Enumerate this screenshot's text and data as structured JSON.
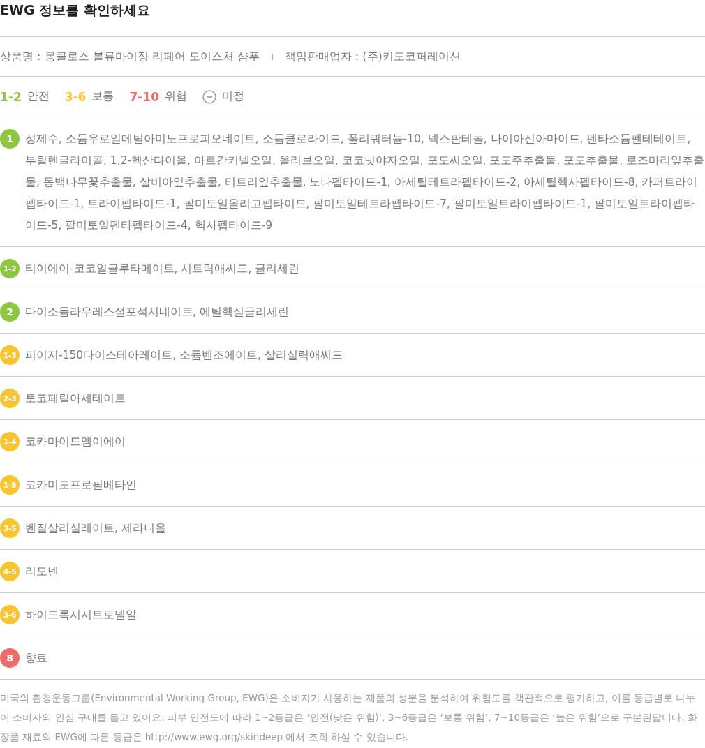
{
  "title": "EWG 정보를 확인하세요",
  "product": {
    "name_label": "상품명 : 몽클로스 볼류마이징 리페어 모이스처 샴푸",
    "separator": "I",
    "seller_label": "책임판매업자 : (주)키도코퍼레이션"
  },
  "legend": [
    {
      "kind": "range",
      "range": "1-2",
      "label": "안전",
      "color": "#8dc63f"
    },
    {
      "kind": "range",
      "range": "3-6",
      "label": "보통",
      "color": "#f7c531"
    },
    {
      "kind": "range",
      "range": "7-10",
      "label": "위험",
      "color": "#ee6b6b"
    },
    {
      "kind": "unrated",
      "label": "미정"
    }
  ],
  "ingredients": [
    {
      "grade": "1",
      "color": "#8dc63f",
      "names": "정제수, 소듐우로일메틸아미노프로피오네이트, 소듐클로라이드, 폴리쿼터늄-10, 덱스판테놀, 나이아신아마이드, 펜타소듐펜테테이트, 부틸렌글라이콜, 1,2-헥산다이올, 아르간커넬오일, 올리브오일, 코코넛야자오일, 포도씨오일, 포도주추출물, 포도추출물, 로즈마리잎추출물, 동백나무꽃추출물, 살비아잎추출물, 티트리잎추출물, 노나펩타이드-1, 아세틸테트라펩타이드-2, 아세틸헥사펩타이드-8, 카퍼트라이펩타이드-1, 트라이펩타이드-1, 팔미토일올리고펩타이드, 팔미토일테트라펩타이드-7, 팔미토일트라이펩타이드-1, 팔미토일트라이펩타이드-5, 팔미토일펜타펩타이드-4, 헥사펩타이드-9"
    },
    {
      "grade": "1-2",
      "color": "#8dc63f",
      "names": "티이에이-코코일글루타메이트, 시트릭애씨드, 글리세린"
    },
    {
      "grade": "2",
      "color": "#8dc63f",
      "names": "다이소듐라우레스설포석시네이트, 에틸헥실글리세린"
    },
    {
      "grade": "1-3",
      "color": "#f7c531",
      "names": "피이지-150다이스테아레이트, 소듐벤조에이트, 살리실릭애씨드"
    },
    {
      "grade": "2-3",
      "color": "#f7c531",
      "names": "토코페릴아세테이트"
    },
    {
      "grade": "1-4",
      "color": "#f7c531",
      "names": "코카마이드엠이에이"
    },
    {
      "grade": "1-5",
      "color": "#f7c531",
      "names": "코카미도프로필베타인"
    },
    {
      "grade": "3-5",
      "color": "#f7c531",
      "names": "벤질살리실레이트, 제라니올"
    },
    {
      "grade": "4-5",
      "color": "#f7c531",
      "names": "리모넨"
    },
    {
      "grade": "3-6",
      "color": "#f7c531",
      "names": "하이드록시시트로넬알"
    },
    {
      "grade": "8",
      "color": "#ee6b6b",
      "names": "향료"
    }
  ],
  "note": "미국의 환경운동그룹(Environmental Working Group, EWG)은 소비자가 사용하는 제품의 성분을 분석하여 위험도를 객관적으로 평가하고, 이를 등급별로 나누어 소비자의 안심 구매를 돕고 있어요. 피부 안전도에 따라 1~2등급은 ‘안전(낮은 위험)’, 3~6등급은 ‘보통 위험’, 7~10등급은 ‘높은 위험’으로 구분된답니다. 화장품 재료의 EWG에 따른 등급은 http://www.ewg.org/skindeep 에서 조회 하실 수 있습니다."
}
